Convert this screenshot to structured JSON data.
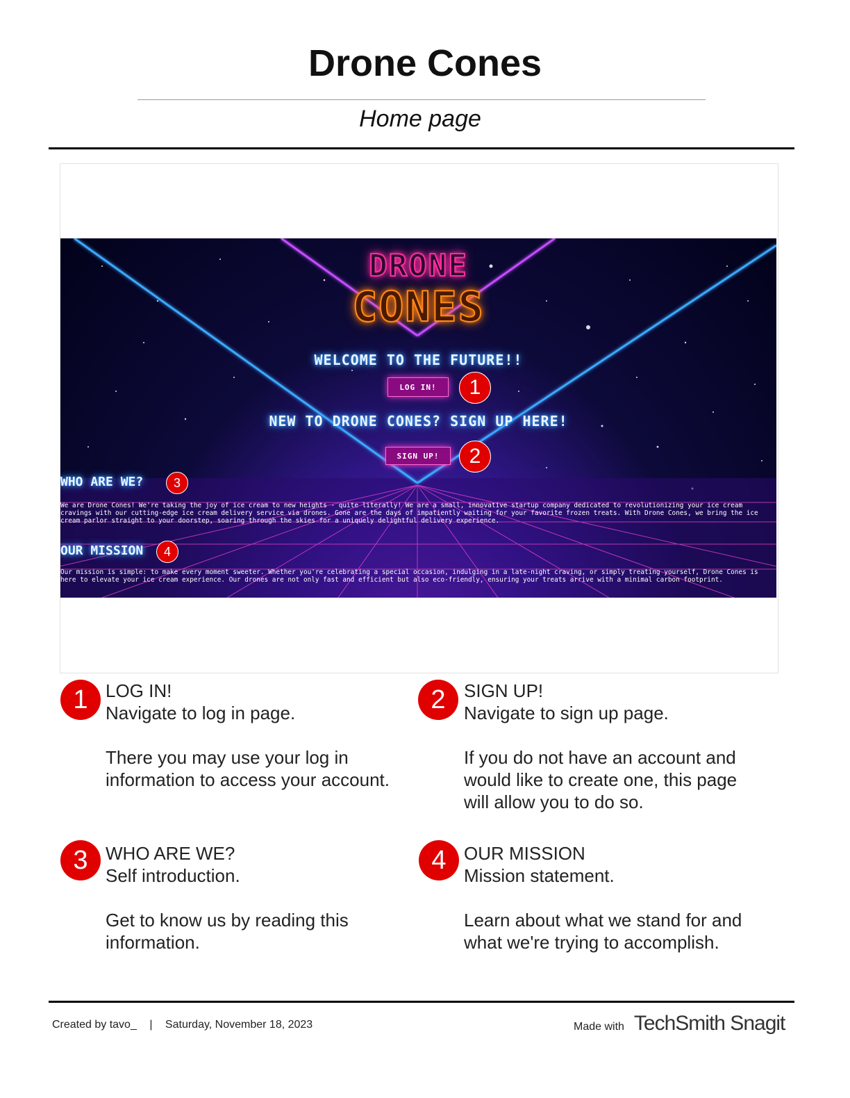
{
  "document": {
    "title": "Drone Cones",
    "subtitle": "Home page"
  },
  "screenshot": {
    "logo_line1": "DRONE",
    "logo_line2": "CONES",
    "welcome": "WELCOME TO THE FUTURE!!",
    "login_button": "LOG IN!",
    "new_to": "NEW TO DRONE CONES? SIGN UP HERE!",
    "signup_button": "SIGN UP!",
    "who_heading": "WHO ARE WE?",
    "who_text": "We are Drone Cones! We're taking the joy of ice cream to new heights - quite literally! We are a small, innovative startup company dedicated to revolutionizing your ice cream cravings with our cutting-edge ice cream delivery service via drones. Gone are the days of impatiently waiting for your favorite frozen treats. With Drone Cones, we bring the ice cream parlor straight to your doorstep, soaring through the skies for a uniquely delightful delivery experience.",
    "mission_heading": "OUR MISSION",
    "mission_text": "Our mission is simple: to make every moment sweeter. Whether you're celebrating a special occasion, indulging in a late-night craving, or simply treating yourself, Drone Cones is here to elevate your ice cream experience. Our drones are not only fast and efficient but also eco-friendly, ensuring your treats arrive with a minimal carbon footprint.",
    "colors": {
      "marker": "#e00000",
      "neon_pink": "#ff2e9e",
      "neon_orange": "#ff8a1a",
      "neon_blue": "#3aa0ff",
      "button_purple": "#8a0a80"
    }
  },
  "markers": [
    "1",
    "2",
    "3",
    "4"
  ],
  "legend": [
    {
      "number": "1",
      "title": "LOG IN!",
      "subtitle": "Navigate to log in page.",
      "detail": "There you may use your log in\ninformation to access your account."
    },
    {
      "number": "2",
      "title": "SIGN UP!",
      "subtitle": "Navigate to sign up page.",
      "detail": "If you do not have an account and\nwould like to create one, this page\nwill allow you to do so."
    },
    {
      "number": "3",
      "title": "WHO ARE WE?",
      "subtitle": "Self introduction.",
      "detail": "Get to know us by reading this\ninformation."
    },
    {
      "number": "4",
      "title": "OUR MISSION",
      "subtitle": "Mission statement.",
      "detail": "Learn about what we stand for and\nwhat we're trying to accomplish."
    }
  ],
  "footer": {
    "created_by": "Created by tavo_",
    "separator": "|",
    "date": "Saturday, November 18, 2023",
    "made_with": "Made with",
    "brand": "TechSmith Snagit"
  }
}
